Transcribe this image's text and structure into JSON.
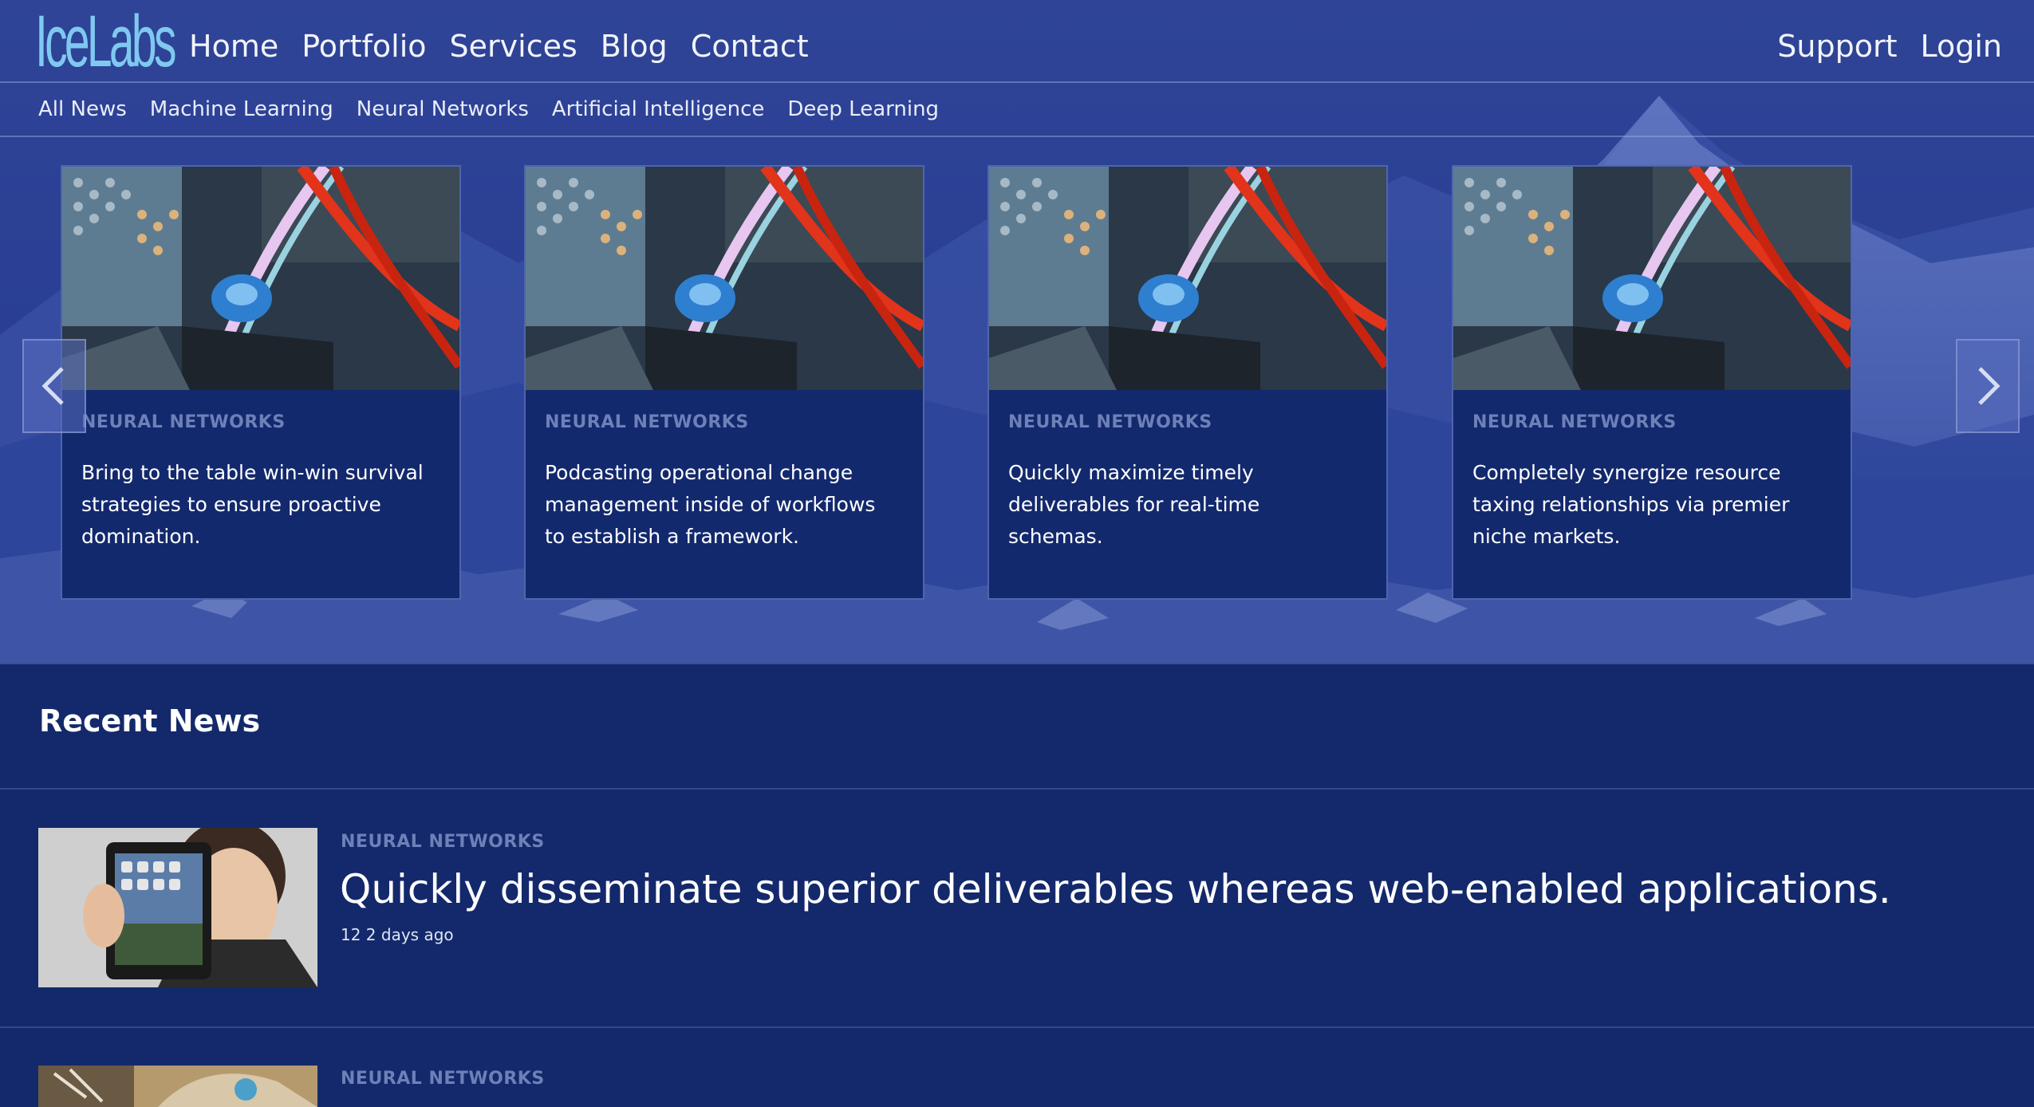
{
  "brand": {
    "logo_text": "IceLabs"
  },
  "main_nav": [
    "Home",
    "Portfolio",
    "Services",
    "Blog",
    "Contact"
  ],
  "util_nav": [
    "Support",
    "Login"
  ],
  "categories": [
    "All News",
    "Machine Learning",
    "Neural Networks",
    "Artificial Intelligence",
    "Deep Learning"
  ],
  "carousel": {
    "cards": [
      {
        "category": "NEURAL NETWORKS",
        "title": "Bring to the table win-win survival strategies to ensure proactive domination."
      },
      {
        "category": "NEURAL NETWORKS",
        "title": "Podcasting operational change management inside of workflows to establish a framework."
      },
      {
        "category": "NEURAL NETWORKS",
        "title": "Quickly maximize timely deliverables for real-time schemas."
      },
      {
        "category": "NEURAL NETWORKS",
        "title": "Completely synergize resource taxing relationships via premier niche markets."
      }
    ],
    "prev_icon": "chevron-left-icon",
    "next_icon": "chevron-right-icon"
  },
  "recent_news": {
    "heading": "Recent News",
    "items": [
      {
        "category": "NEURAL NETWORKS",
        "title": "Quickly disseminate superior deliverables whereas web-enabled applications.",
        "meta": "12 2 days ago"
      },
      {
        "category": "NEURAL NETWORKS"
      }
    ]
  },
  "colors": {
    "background": "#14296b",
    "card_background": "#13296e",
    "category_text": "#6e80b8",
    "logo": "#7fc9f0"
  }
}
